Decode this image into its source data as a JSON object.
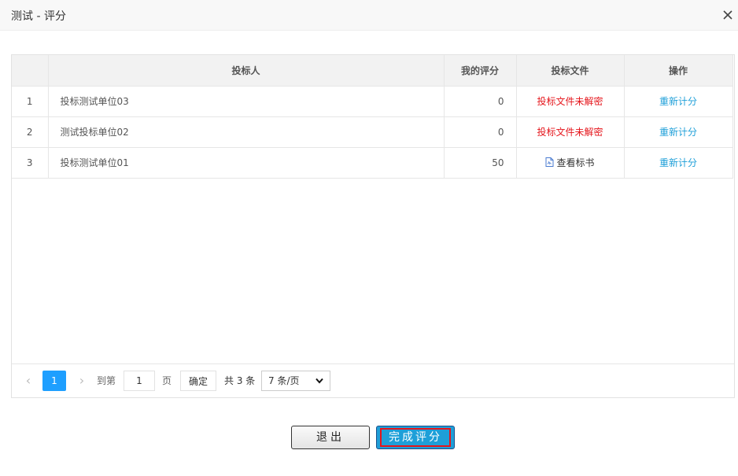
{
  "dialog": {
    "title": "测试 - 评分"
  },
  "table": {
    "headers": {
      "index": "",
      "bidder": "投标人",
      "my_score": "我的评分",
      "bid_file": "投标文件",
      "action": "操作"
    },
    "rows": [
      {
        "index": "1",
        "bidder": "投标测试单位03",
        "score": "0",
        "file": "投标文件未解密",
        "file_state": "not-decrypted",
        "action": "重新计分"
      },
      {
        "index": "2",
        "bidder": "测试投标单位02",
        "score": "0",
        "file": "投标文件未解密",
        "file_state": "not-decrypted",
        "action": "重新计分"
      },
      {
        "index": "3",
        "bidder": "投标测试单位01",
        "score": "50",
        "file": "查看标书",
        "file_state": "viewable",
        "file_icon": "pdf-file-icon",
        "action": "重新计分"
      }
    ]
  },
  "pagination": {
    "current_page": "1",
    "goto_label": "到第",
    "goto_value": "1",
    "page_label": "页",
    "confirm_label": "确定",
    "total_label": "共 3 条",
    "page_size": "7 条/页"
  },
  "buttons": {
    "exit": "退出",
    "finish": "完成评分"
  },
  "colors": {
    "accent": "#1e9fd8",
    "page_active": "#1e9fff",
    "warning": "#e5161c"
  }
}
